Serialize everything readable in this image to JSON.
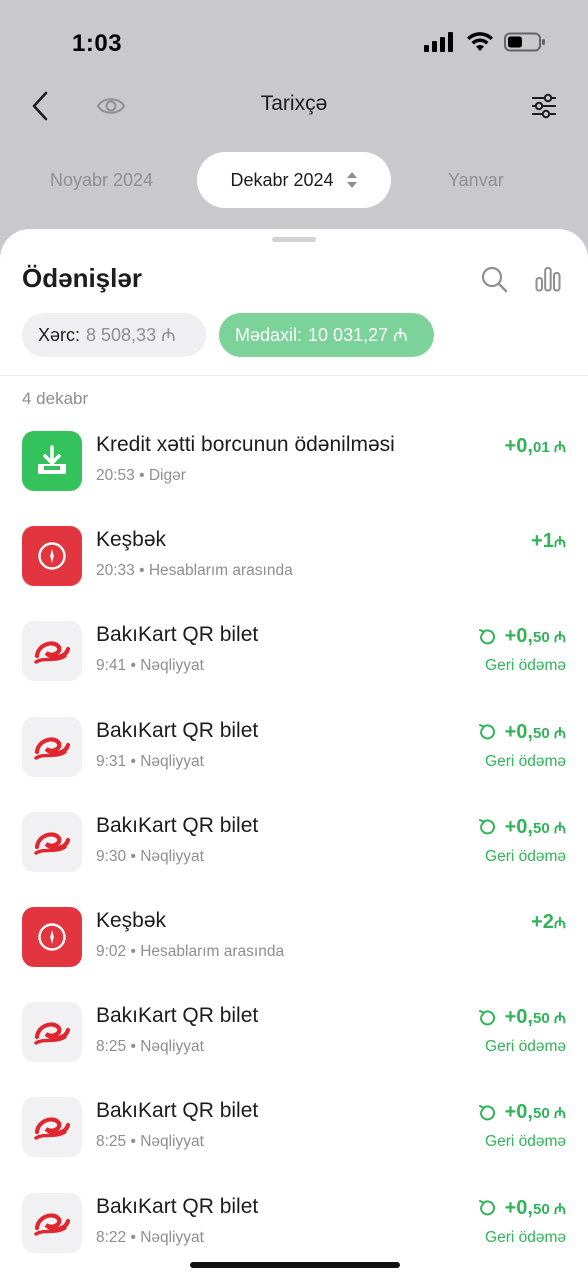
{
  "status": {
    "time": "1:03"
  },
  "nav": {
    "title": "Tarixçə"
  },
  "months": {
    "prev": "Noyabr 2024",
    "current": "Dekabr 2024",
    "next": "Yanvar"
  },
  "sheet": {
    "title": "Ödənişlər",
    "expense_label": "Xərc:",
    "expense_value": "8 508,33 ₼",
    "income_label": "Mədaxil:",
    "income_value": "10 031,27 ₼"
  },
  "date_label": "4 dekabr",
  "transactions": [
    {
      "icon": "download-icon",
      "title": "Kredit xətti borcunun ödənilməsi",
      "subtitle": "20:53 • Digər",
      "amount_main": "+0,",
      "amount_small": "01 ₼",
      "note": ""
    },
    {
      "icon": "cashback-icon",
      "title": "Keşbək",
      "subtitle": "20:33 • Hesablarım arasında",
      "amount_main": "+1",
      "amount_small": "₼",
      "note": ""
    },
    {
      "icon": "bakikart-icon",
      "title": "BakıKart QR bilet",
      "subtitle": "9:41 • Nəqliyyat",
      "amount_main": "+0,",
      "amount_small": "50 ₼",
      "note": "Geri ödəmə"
    },
    {
      "icon": "bakikart-icon",
      "title": "BakıKart QR bilet",
      "subtitle": "9:31 • Nəqliyyat",
      "amount_main": "+0,",
      "amount_small": "50 ₼",
      "note": "Geri ödəmə"
    },
    {
      "icon": "bakikart-icon",
      "title": "BakıKart QR bilet",
      "subtitle": "9:30 • Nəqliyyat",
      "amount_main": "+0,",
      "amount_small": "50 ₼",
      "note": "Geri ödəmə"
    },
    {
      "icon": "cashback-icon",
      "title": "Keşbək",
      "subtitle": "9:02 • Hesablarım arasında",
      "amount_main": "+2",
      "amount_small": "₼",
      "note": ""
    },
    {
      "icon": "bakikart-icon",
      "title": "BakıKart QR bilet",
      "subtitle": "8:25 • Nəqliyyat",
      "amount_main": "+0,",
      "amount_small": "50 ₼",
      "note": "Geri ödəmə"
    },
    {
      "icon": "bakikart-icon",
      "title": "BakıKart QR bilet",
      "subtitle": "8:25 • Nəqliyyat",
      "amount_main": "+0,",
      "amount_small": "50 ₼",
      "note": "Geri ödəmə"
    },
    {
      "icon": "bakikart-icon",
      "title": "BakıKart QR bilet",
      "subtitle": "8:22 • Nəqliyyat",
      "amount_main": "+0,",
      "amount_small": "50 ₼",
      "note": "Geri ödəmə"
    }
  ],
  "colors": {
    "income_green": "#2fb457",
    "chip_green": "#7cd39a",
    "cashback_red": "#e23540",
    "download_green": "#33c25c"
  }
}
